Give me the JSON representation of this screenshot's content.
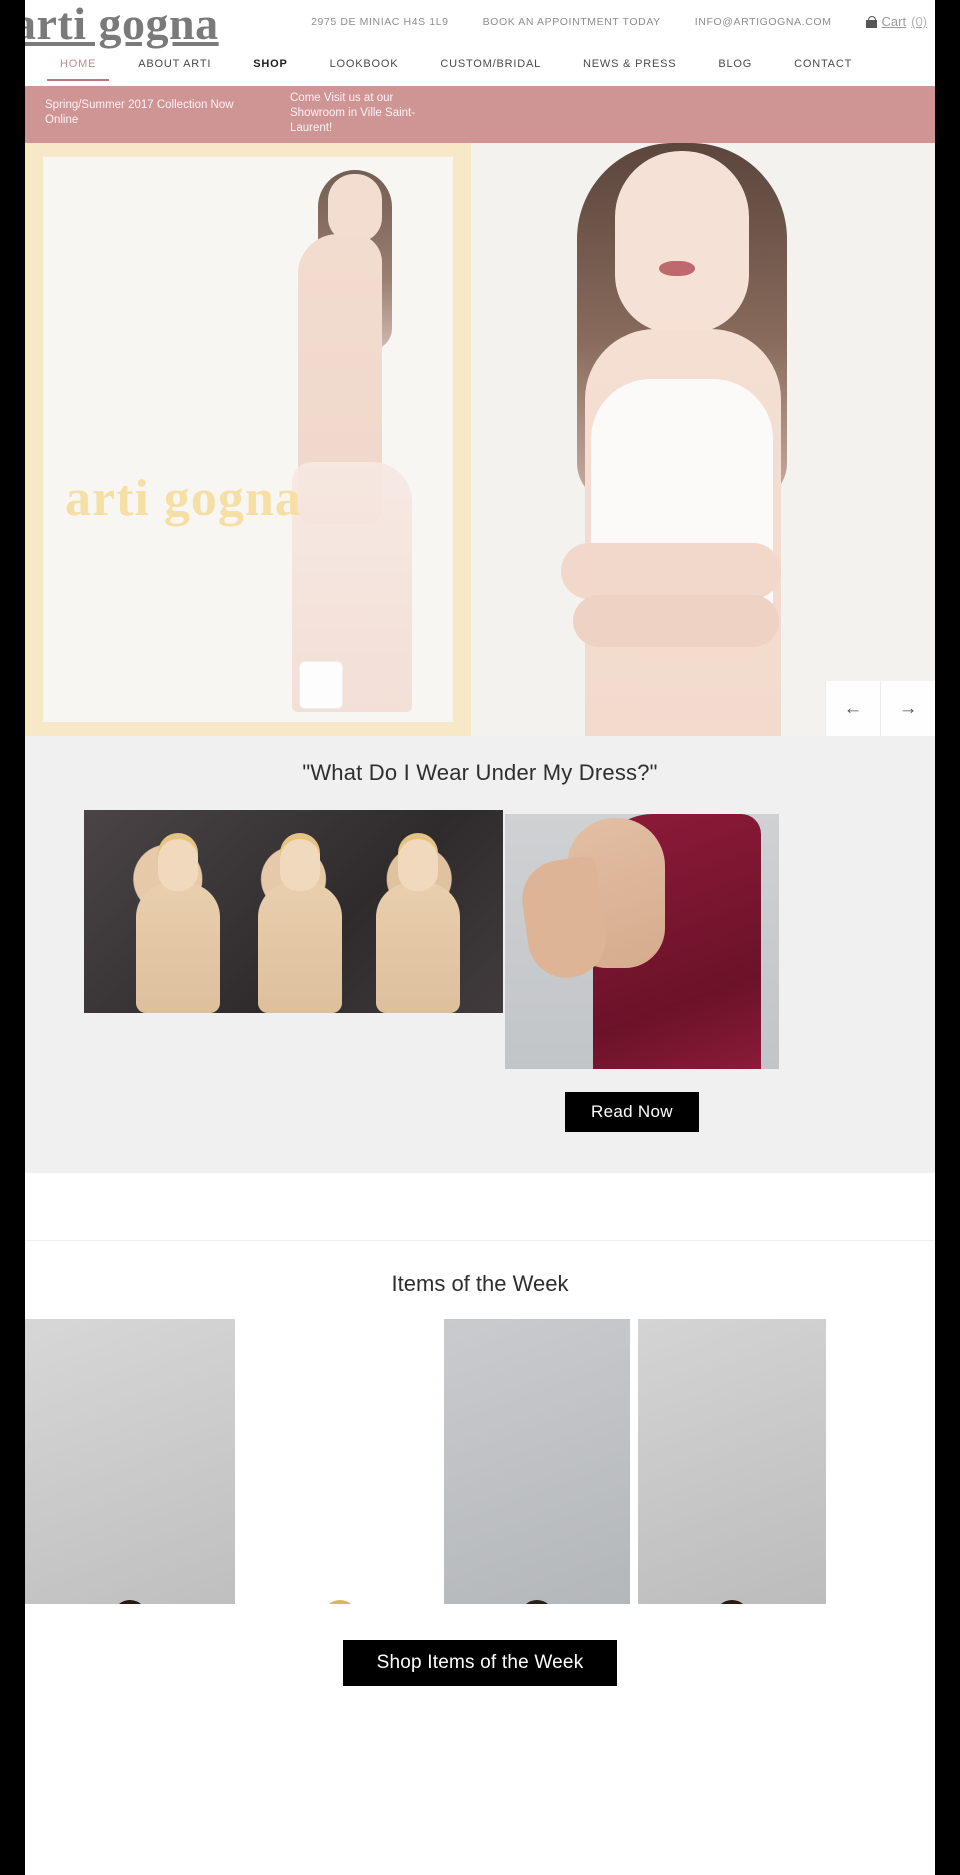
{
  "brand": {
    "logo_text": "arti gogna"
  },
  "topbar": {
    "address": "2975 DE MINIAC H4S 1L9",
    "appointment": "BOOK AN APPOINTMENT TODAY",
    "email": "INFO@ARTIGOGNA.COM",
    "cart_label": "Cart",
    "cart_count": "(0)",
    "cart_icon": "shopping-bag-icon"
  },
  "nav": {
    "items": [
      {
        "label": "HOME",
        "state": "active"
      },
      {
        "label": "ABOUT ARTI",
        "state": "normal"
      },
      {
        "label": "SHOP",
        "state": "bold"
      },
      {
        "label": "LOOKBOOK",
        "state": "normal"
      },
      {
        "label": "CUSTOM/BRIDAL",
        "state": "normal"
      },
      {
        "label": "NEWS & PRESS",
        "state": "normal"
      },
      {
        "label": "BLOG",
        "state": "normal"
      },
      {
        "label": "CONTACT",
        "state": "normal"
      }
    ]
  },
  "banner": {
    "background_color": "#cf9494",
    "left_text": "Spring/Summer 2017 Collection Now Online",
    "right_text": "Come Visit us at our Showroom in Ville Saint-Laurent!"
  },
  "hero": {
    "wordmark": "arti gogna",
    "prev_icon": "arrow-left-icon",
    "next_icon": "arrow-right-icon",
    "prev_glyph": "←",
    "next_glyph": "→",
    "frame_color": "#f7e9c8"
  },
  "feature": {
    "title": "\"What Do I Wear Under My Dress?\"",
    "cta_label": "Read Now",
    "background_color": "#f0f0f0"
  },
  "items_of_the_week": {
    "title": "Items of the Week",
    "cta_label": "Shop Items of the Week",
    "products": [
      {
        "name": "black-backless-gown"
      },
      {
        "name": "red-cutout-gown"
      },
      {
        "name": "black-cutout-gown"
      },
      {
        "name": "red-backless-gown"
      }
    ]
  },
  "theme": {
    "accent_rose": "#c08a8a",
    "banner_rose": "#cf9494",
    "hero_cream": "#f7e9c8",
    "button_black": "#000000",
    "feature_grey": "#f0f0f0"
  }
}
